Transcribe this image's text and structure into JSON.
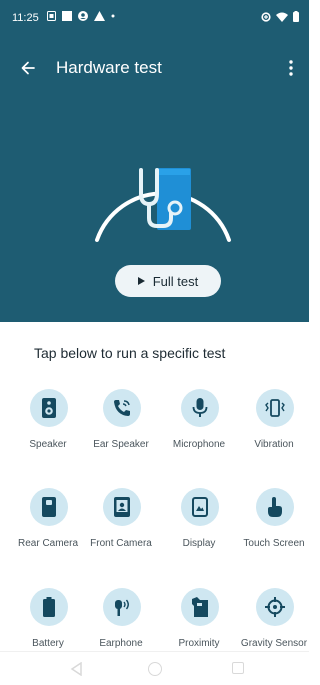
{
  "status_bar": {
    "time": "11:25",
    "icons_left": [
      "sim-card-icon",
      "square-icon",
      "account-icon",
      "warning-icon",
      "dot-icon"
    ],
    "icons_right": [
      "data-saver-icon",
      "wifi-icon",
      "battery-icon"
    ]
  },
  "app_bar": {
    "title": "Hardware test",
    "back_icon": "arrow-back-icon",
    "menu_icon": "more-vert-icon"
  },
  "hero": {
    "icon": "stethoscope-phone-icon"
  },
  "full_test_button": {
    "label": "Full test",
    "icon": "play-icon"
  },
  "section": {
    "title": "Tap below to run a specific test"
  },
  "tests": [
    {
      "label": "Speaker",
      "icon": "speaker-icon"
    },
    {
      "label": "Ear Speaker",
      "icon": "phone-in-talk-icon"
    },
    {
      "label": "Microphone",
      "icon": "microphone-icon"
    },
    {
      "label": "Vibration",
      "icon": "vibration-icon"
    },
    {
      "label": "Rear Camera",
      "icon": "rear-camera-icon"
    },
    {
      "label": "Front Camera",
      "icon": "front-camera-icon"
    },
    {
      "label": "Display",
      "icon": "display-icon"
    },
    {
      "label": "Touch Screen",
      "icon": "touch-icon"
    },
    {
      "label": "Battery",
      "icon": "battery-icon"
    },
    {
      "label": "Earphone",
      "icon": "earphone-icon"
    },
    {
      "label": "Proximity",
      "icon": "proximity-icon"
    },
    {
      "label": "Gravity Sensor",
      "icon": "gravity-sensor-icon"
    }
  ],
  "colors": {
    "header_bg": "#1e5c72",
    "icon_circle": "#cfe7f1",
    "icon_fg": "#15495f",
    "button_bg": "#eef4f7"
  }
}
